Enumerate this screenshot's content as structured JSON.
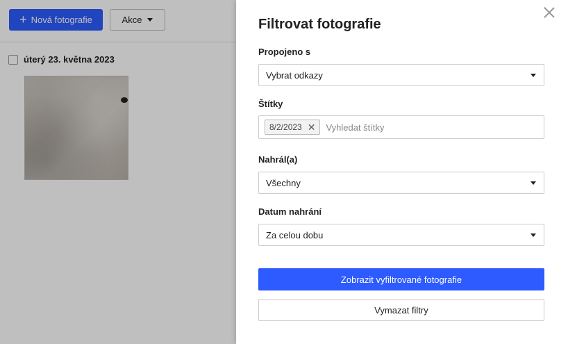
{
  "background": {
    "new_photo_label": "Nová fotografie",
    "actions_label": "Akce",
    "date_group_label": "úterý 23. května 2023"
  },
  "modal": {
    "title": "Filtrovat fotografie",
    "linked": {
      "label": "Propojeno s",
      "value": "Vybrat odkazy"
    },
    "tags": {
      "label": "Štítky",
      "chips": [
        "8/2/2023"
      ],
      "placeholder": "Vyhledat štítky"
    },
    "uploaded_by": {
      "label": "Nahrál(a)",
      "value": "Všechny"
    },
    "upload_date": {
      "label": "Datum nahrání",
      "value": "Za celou dobu"
    },
    "apply_label": "Zobrazit vyfiltrované fotografie",
    "clear_label": "Vymazat filtry"
  },
  "colors": {
    "accent": "#2d5bff",
    "overlay": "rgba(0,0,0,0.25)"
  }
}
